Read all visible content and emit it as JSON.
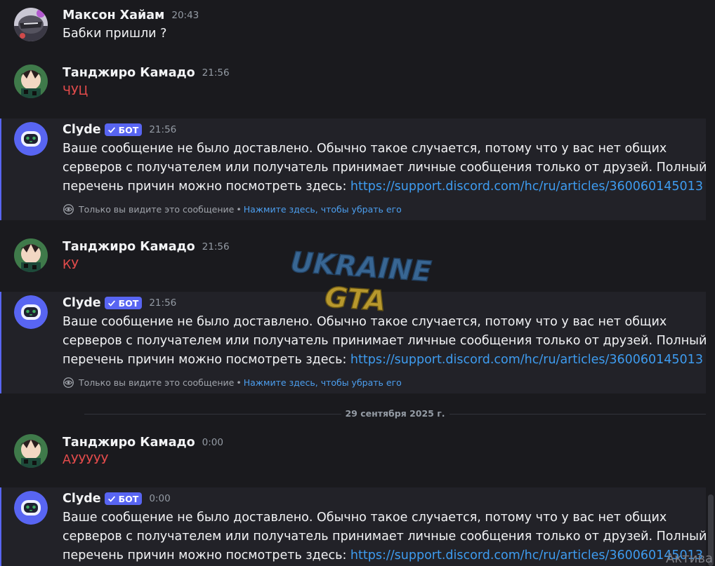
{
  "messages": {
    "m1": {
      "author": "Максон Хайам",
      "time": "20:43",
      "text": "Бабки пришли ?"
    },
    "m2": {
      "author": "Танджиро Камадо",
      "time": "21:56",
      "text": "ЧУЦ"
    },
    "m3": {
      "author": "Clyde",
      "badge": "БОТ",
      "time": "21:56",
      "line1": "Ваше сообщение не было доставлено. Обычно такое случается, потому что у вас нет общих",
      "line2": "серверов с получателем или получатель принимает личные сообщения только от друзей. Полный",
      "line3_prefix": "перечень причин можно посмотреть здесь: ",
      "link": "https://support.discord.com/hc/ru/articles/360060145013",
      "ephemeral": "Только вы видите это сообщение",
      "separator": "•",
      "dismiss": "Нажмите здесь, чтобы убрать его"
    },
    "m4": {
      "author": "Танджиро Камадо",
      "time": "21:56",
      "text": "КУ"
    },
    "m5": {
      "author": "Clyde",
      "badge": "БОТ",
      "time": "21:56",
      "line1": "Ваше сообщение не было доставлено. Обычно такое случается, потому что у вас нет общих",
      "line2": "серверов с получателем или получатель принимает личные сообщения только от друзей. Полный",
      "line3_prefix": "перечень причин можно посмотреть здесь: ",
      "link": "https://support.discord.com/hc/ru/articles/360060145013",
      "ephemeral": "Только вы видите это сообщение",
      "separator": "•",
      "dismiss": "Нажмите здесь, чтобы убрать его"
    },
    "m6": {
      "author": "Танджиро Камадо",
      "time": "0:00",
      "text": "АУУУУУ"
    },
    "m7": {
      "author": "Clyde",
      "badge": "БОТ",
      "time": "0:00",
      "line1": "Ваше сообщение не было доставлено. Обычно такое случается, потому что у вас нет общих",
      "line2": "серверов с получателем или получатель принимает личные сообщения только от друзей. Полный",
      "line3_prefix": "перечень причин можно посмотреть здесь: ",
      "link": "https://support.discord.com/hc/ru/articles/360060145013"
    }
  },
  "date_divider": "29 сентября 2025 г.",
  "watermark": {
    "line1": "UKRAINE",
    "line2": "GTA"
  },
  "overlay": {
    "activate": "Актива"
  },
  "colors": {
    "accent": "#5865f2",
    "link": "#3e9cf0",
    "red_text": "#e14b4b",
    "background": "#1a1a1e"
  }
}
